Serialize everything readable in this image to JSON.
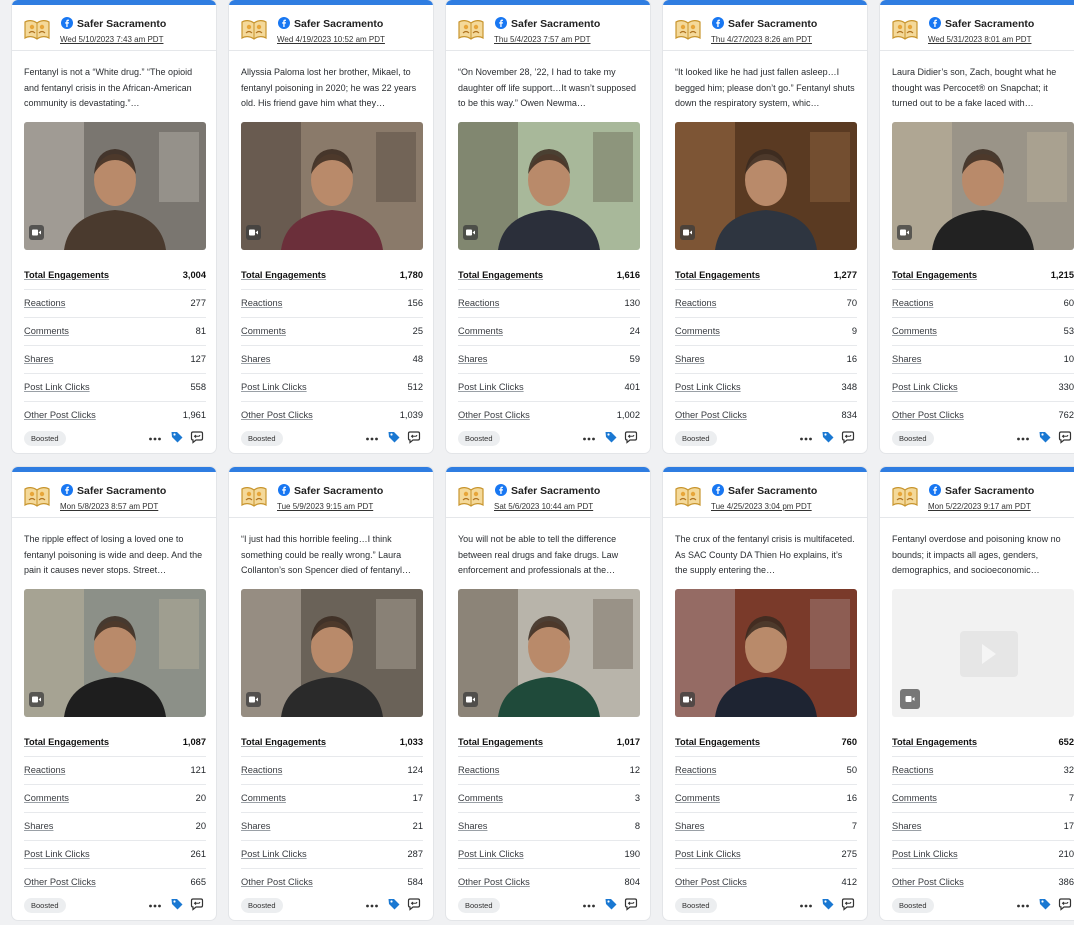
{
  "colors": {
    "accent": "#2f7de1",
    "facebook": "#1877f2",
    "card_bg": "#ffffff"
  },
  "labels": {
    "total": "Total Engagements",
    "reactions": "Reactions",
    "comments": "Comments",
    "shares": "Shares",
    "post_link_clicks": "Post Link Clicks",
    "other_post_clicks": "Other Post Clicks",
    "boosted": "Boosted"
  },
  "icons": {
    "page_logo": "safer-sacramento-logo-icon",
    "network": "facebook-icon",
    "media": "video-icon",
    "more": "more-icon",
    "tag": "tag-icon",
    "reply": "reply-icon"
  },
  "posts": [
    {
      "page": "Safer Sacramento",
      "date": "Wed 5/10/2023 7:43 am PDT",
      "text": "Fentanyl is not a “White drug.” “The opioid and fentanyl crisis in the African-American community is devastating.”…",
      "total": "3,004",
      "reactions": "277",
      "comments": "81",
      "shares": "127",
      "post_link_clicks": "558",
      "other_post_clicks": "1,961",
      "thumb": {
        "bg": "#7a7670",
        "fg": "#4a3a2e",
        "accent": "#e8e3d8"
      }
    },
    {
      "page": "Safer Sacramento",
      "date": "Wed 4/19/2023 10:52 am PDT",
      "text": "Allyssia Paloma lost her brother, Mikael, to fentanyl poisoning in 2020; he was 22 years old. His friend gave him what they…",
      "total": "1,780",
      "reactions": "156",
      "comments": "25",
      "shares": "48",
      "post_link_clicks": "512",
      "other_post_clicks": "1,039",
      "thumb": {
        "bg": "#8a7a6a",
        "fg": "#6b2f3a",
        "accent": "#2a2320"
      }
    },
    {
      "page": "Safer Sacramento",
      "date": "Thu 5/4/2023 7:57 am PDT",
      "text": "“On November 28, ’22, I had to take my daughter off life support…It wasn’t supposed to be this way.” Owen Newma…",
      "total": "1,616",
      "reactions": "130",
      "comments": "24",
      "shares": "59",
      "post_link_clicks": "401",
      "other_post_clicks": "1,002",
      "thumb": {
        "bg": "#a8b89a",
        "fg": "#2b2f3a",
        "accent": "#3a2a22"
      }
    },
    {
      "page": "Safer Sacramento",
      "date": "Thu 4/27/2023 8:26 am PDT",
      "text": "“It looked like he had just fallen asleep…I begged him; please don’t go.” Fentanyl shuts down the respiratory system, whic…",
      "total": "1,277",
      "reactions": "70",
      "comments": "9",
      "shares": "16",
      "post_link_clicks": "348",
      "other_post_clicks": "834",
      "thumb": {
        "bg": "#5a3a22",
        "fg": "#2e3540",
        "accent": "#c08a5a"
      }
    },
    {
      "page": "Safer Sacramento",
      "date": "Wed 5/31/2023 8:01 am PDT",
      "text": "Laura Didier’s son, Zach, bought what he thought was Percocet® on Snapchat; it turned out to be a fake laced with…",
      "total": "1,215",
      "reactions": "60",
      "comments": "53",
      "shares": "10",
      "post_link_clicks": "330",
      "other_post_clicks": "762",
      "thumb": {
        "bg": "#9a9488",
        "fg": "#222222",
        "accent": "#d8c8a8"
      }
    },
    {
      "page": "Safer Sacramento",
      "date": "Mon 5/8/2023 8:57 am PDT",
      "text": "The ripple effect of losing a loved one to fentanyl poisoning is wide and deep. And the pain it causes never stops. Street…",
      "total": "1,087",
      "reactions": "121",
      "comments": "20",
      "shares": "20",
      "post_link_clicks": "261",
      "other_post_clicks": "665",
      "thumb": {
        "bg": "#8c9088",
        "fg": "#1e1e1e",
        "accent": "#d8c8a8"
      }
    },
    {
      "page": "Safer Sacramento",
      "date": "Tue 5/9/2023 9:15 am PDT",
      "text": "“I just had this horrible feeling…I think something could be really wrong.” Laura Collanton’s son Spencer died of fentanyl…",
      "total": "1,033",
      "reactions": "124",
      "comments": "17",
      "shares": "21",
      "post_link_clicks": "287",
      "other_post_clicks": "584",
      "thumb": {
        "bg": "#6a6258",
        "fg": "#2a2a2a",
        "accent": "#e8e0d0"
      }
    },
    {
      "page": "Safer Sacramento",
      "date": "Sat 5/6/2023 10:44 am PDT",
      "text": "You will not be able to tell the difference between real drugs and fake drugs. Law enforcement and professionals at the…",
      "total": "1,017",
      "reactions": "12",
      "comments": "3",
      "shares": "8",
      "post_link_clicks": "190",
      "other_post_clicks": "804",
      "thumb": {
        "bg": "#b8b4aa",
        "fg": "#1f4a3a",
        "accent": "#3a2a1e"
      }
    },
    {
      "page": "Safer Sacramento",
      "date": "Tue 4/25/2023 3:04 pm PDT",
      "text": "The crux of the fentanyl crisis is multifaceted. As SAC County DA Thien Ho explains, it’s the supply entering the…",
      "total": "760",
      "reactions": "50",
      "comments": "16",
      "shares": "7",
      "post_link_clicks": "275",
      "other_post_clicks": "412",
      "thumb": {
        "bg": "#7a3a2a",
        "fg": "#1e2432",
        "accent": "#c8c8d0"
      }
    },
    {
      "page": "Safer Sacramento",
      "date": "Mon 5/22/2023 9:17 am PDT",
      "text": "Fentanyl overdose and poisoning know no bounds; it impacts all ages, genders, demographics, and socioeconomic…",
      "total": "652",
      "reactions": "32",
      "comments": "7",
      "shares": "17",
      "post_link_clicks": "210",
      "other_post_clicks": "386",
      "thumb": null
    }
  ]
}
